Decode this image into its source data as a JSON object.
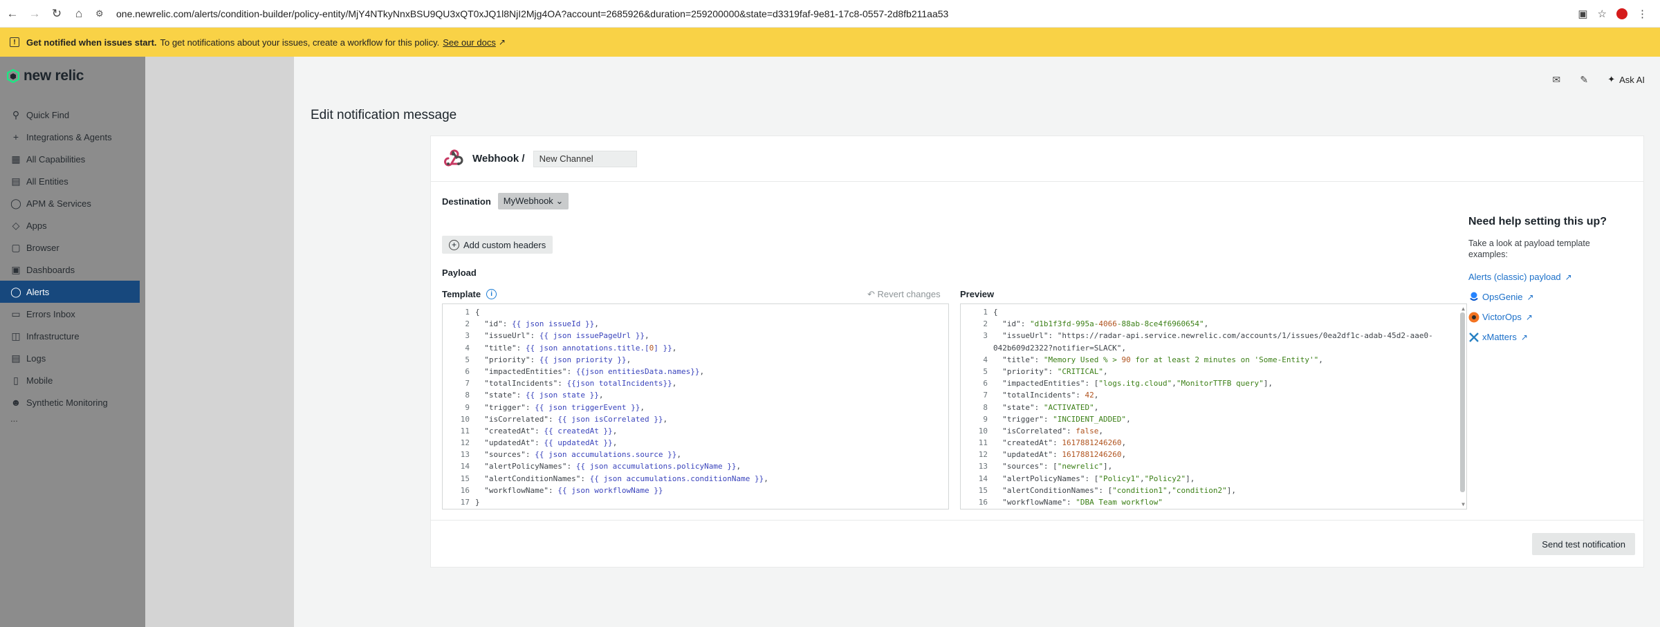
{
  "browser": {
    "url": "one.newrelic.com/alerts/condition-builder/policy-entity/MjY4NTkyNnxBSU9QU3xQT0xJQ1l8NjI2Mjg4OA?account=2685926&duration=259200000&state=d3319faf-9e81-17c8-0557-2d8fb211aa53"
  },
  "banner": {
    "bold": "Get notified when issues start.",
    "text": "To get notifications about your issues, create a workflow for this policy.",
    "link": "See our docs"
  },
  "nav": {
    "logo": "new relic",
    "items": [
      {
        "label": "Quick Find",
        "icon": "search-icon"
      },
      {
        "label": "Integrations & Agents",
        "icon": "plus-icon"
      },
      {
        "label": "All Capabilities",
        "icon": "grid-icon"
      },
      {
        "label": "All Entities",
        "icon": "entities-icon"
      },
      {
        "label": "APM & Services",
        "icon": "globe-icon"
      },
      {
        "label": "Apps",
        "icon": "layers-icon"
      },
      {
        "label": "Browser",
        "icon": "browser-icon"
      },
      {
        "label": "Dashboards",
        "icon": "dashboard-icon"
      },
      {
        "label": "Alerts",
        "icon": "alert-icon"
      },
      {
        "label": "Errors Inbox",
        "icon": "inbox-icon"
      },
      {
        "label": "Infrastructure",
        "icon": "infrastructure-icon"
      },
      {
        "label": "Logs",
        "icon": "logs-icon"
      },
      {
        "label": "Mobile",
        "icon": "mobile-icon"
      },
      {
        "label": "Synthetic Monitoring",
        "icon": "synthetic-icon"
      }
    ],
    "more": "...",
    "active": "Alerts"
  },
  "topbar": {
    "ask_ai": "Ask AI"
  },
  "page": {
    "title": "Edit notification message",
    "channel_type": "Webhook /",
    "channel_name": "New Channel",
    "destination_label": "Destination",
    "destination_value": "MyWebhook",
    "add_headers": "Add custom headers",
    "payload_label": "Payload",
    "template_label": "Template",
    "revert": "Revert changes",
    "preview_label": "Preview",
    "send_test": "Send test notification"
  },
  "template_lines": [
    "{",
    "  \"id\": {{ json issueId }},",
    "  \"issueUrl\": {{ json issuePageUrl }},",
    "  \"title\": {{ json annotations.title.[0] }},",
    "  \"priority\": {{ json priority }},",
    "  \"impactedEntities\": {{json entitiesData.names}},",
    "  \"totalIncidents\": {{json totalIncidents}},",
    "  \"state\": {{ json state }},",
    "  \"trigger\": {{ json triggerEvent }},",
    "  \"isCorrelated\": {{ json isCorrelated }},",
    "  \"createdAt\": {{ createdAt }},",
    "  \"updatedAt\": {{ updatedAt }},",
    "  \"sources\": {{ json accumulations.source }},",
    "  \"alertPolicyNames\": {{ json accumulations.policyName }},",
    "  \"alertConditionNames\": {{ json accumulations.conditionName }},",
    "  \"workflowName\": {{ json workflowName }}",
    "}"
  ],
  "preview_lines": [
    {
      "n": "1",
      "t": "{"
    },
    {
      "n": "2",
      "t": "  \"id\": \"d1b1f3fd-995a-4066-88ab-8ce4f6960654\","
    },
    {
      "n": "3",
      "t": "  \"issueUrl\": \"https://radar-api.service.newrelic.com/accounts/1/issues/0ea2df1c-adab-45d2-aae0-"
    },
    {
      "n": "",
      "t": "042b609d2322?notifier=SLACK\","
    },
    {
      "n": "4",
      "t": "  \"title\": \"Memory Used % > 90 for at least 2 minutes on 'Some-Entity'\","
    },
    {
      "n": "5",
      "t": "  \"priority\": \"CRITICAL\","
    },
    {
      "n": "6",
      "t": "  \"impactedEntities\": [\"logs.itg.cloud\",\"MonitorTTFB query\"],"
    },
    {
      "n": "7",
      "t": "  \"totalIncidents\": 42,"
    },
    {
      "n": "8",
      "t": "  \"state\": \"ACTIVATED\","
    },
    {
      "n": "9",
      "t": "  \"trigger\": \"INCIDENT_ADDED\","
    },
    {
      "n": "10",
      "t": "  \"isCorrelated\": false,"
    },
    {
      "n": "11",
      "t": "  \"createdAt\": 1617881246260,"
    },
    {
      "n": "12",
      "t": "  \"updatedAt\": 1617881246260,"
    },
    {
      "n": "13",
      "t": "  \"sources\": [\"newrelic\"],"
    },
    {
      "n": "14",
      "t": "  \"alertPolicyNames\": [\"Policy1\",\"Policy2\"],"
    },
    {
      "n": "15",
      "t": "  \"alertConditionNames\": [\"condition1\",\"condition2\"],"
    },
    {
      "n": "16",
      "t": "  \"workflowName\": \"DBA Team workflow\""
    }
  ],
  "help": {
    "title": "Need help setting this up?",
    "text": "Take a look at payload template examples:",
    "links": [
      {
        "label": "Alerts (classic) payload",
        "icon": ""
      },
      {
        "label": "OpsGenie",
        "icon": "opsgenie-icon"
      },
      {
        "label": "VictorOps",
        "icon": "victorops-icon"
      },
      {
        "label": "xMatters",
        "icon": "xmatters-icon"
      }
    ]
  },
  "colors": {
    "banner": "#f9d246",
    "nav_active": "#17487d",
    "link": "#1a6fc9"
  }
}
